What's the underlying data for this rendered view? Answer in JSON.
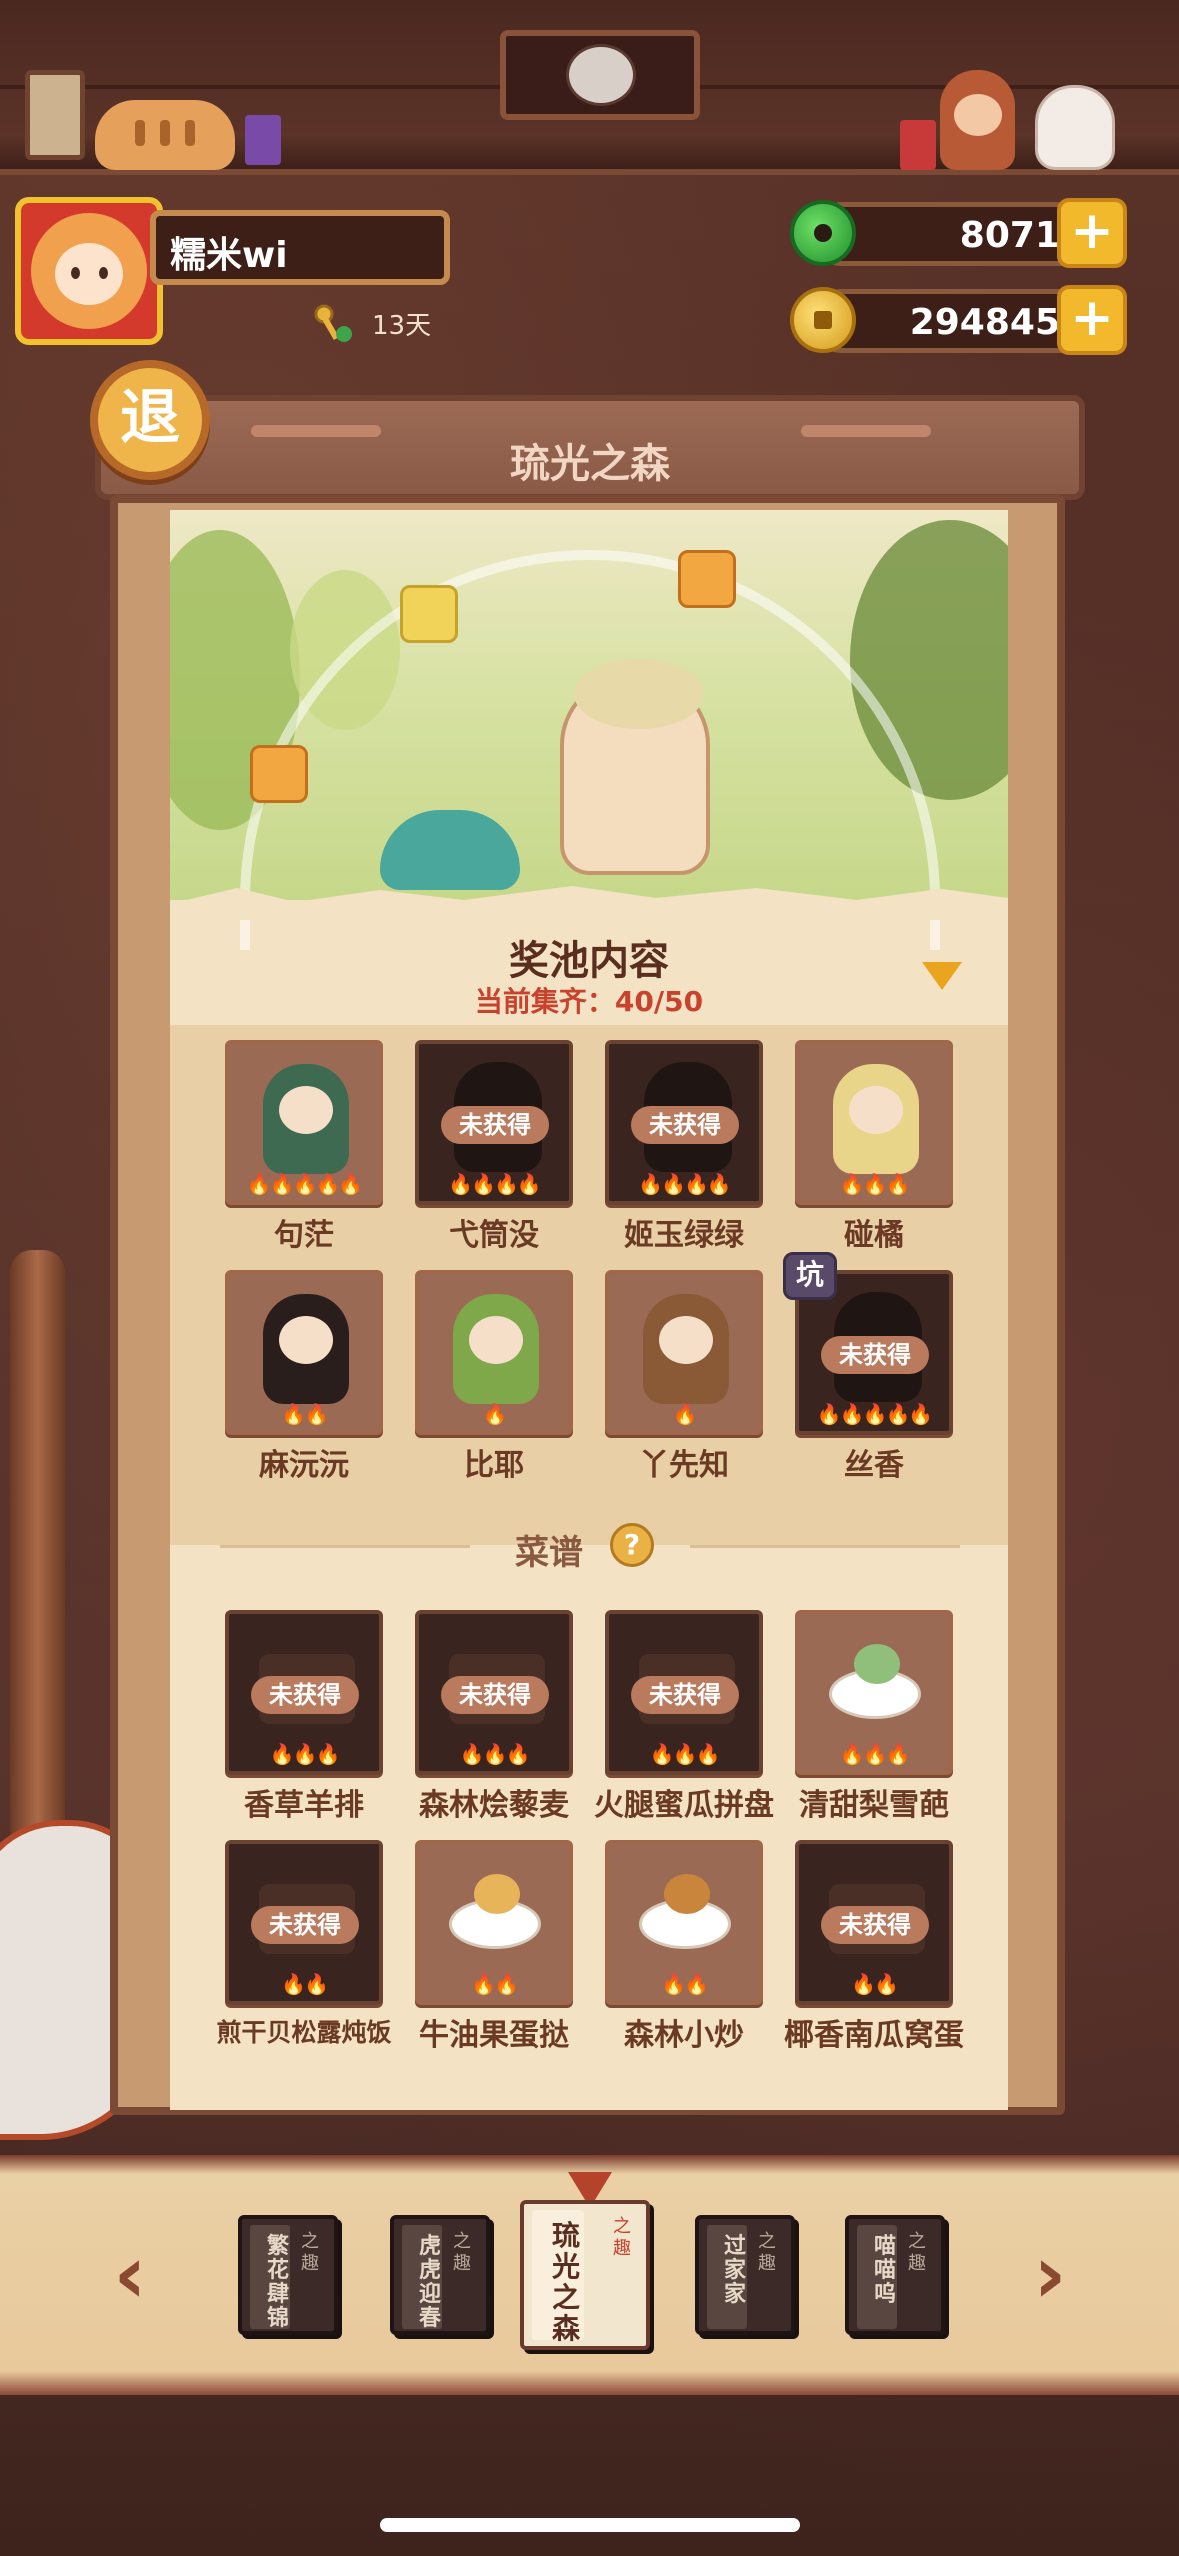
{
  "player": {
    "name": "糯米wi",
    "days": "13天"
  },
  "resources": {
    "jade": "8071",
    "coins": "294845",
    "plus": "+"
  },
  "exit_label": "退",
  "title": "琉光之森",
  "pool": {
    "title": "奖池内容",
    "progress": "当前集齐：40/50"
  },
  "locked_badge": "未获得",
  "pit_tag": "坑",
  "characters": [
    {
      "name": "句茫",
      "owned": true,
      "flames": "🔥🔥🔥🔥🔥",
      "color": "#3e6a52"
    },
    {
      "name": "弋筒没",
      "owned": false,
      "flames": "🔥🔥🔥🔥"
    },
    {
      "name": "姬玉绿绿",
      "owned": false,
      "flames": "🔥🔥🔥🔥"
    },
    {
      "name": "碰橘",
      "owned": true,
      "flames": "🔥🔥🔥",
      "color": "#e9d58a"
    },
    {
      "name": "麻沅沅",
      "owned": true,
      "flames": "🔥🔥",
      "color": "#2a1e1c"
    },
    {
      "name": "比耶",
      "owned": true,
      "flames": "🔥",
      "color": "#7ea84a"
    },
    {
      "name": "丫先知",
      "owned": true,
      "flames": "🔥",
      "color": "#8a5a36"
    },
    {
      "name": "丝香",
      "owned": false,
      "flames": "🔥🔥🔥🔥🔥"
    }
  ],
  "recipes_title": "菜谱",
  "help_icon": "?",
  "recipes": [
    {
      "name": "香草羊排",
      "owned": false,
      "flames": "🔥🔥🔥"
    },
    {
      "name": "森林烩藜麦",
      "owned": false,
      "flames": "🔥🔥🔥"
    },
    {
      "name": "火腿蜜瓜拼盘",
      "owned": false,
      "flames": "🔥🔥🔥"
    },
    {
      "name": "清甜梨雪葩",
      "owned": true,
      "flames": "🔥🔥🔥"
    },
    {
      "name": "煎干贝松露炖饭",
      "owned": false,
      "flames": "🔥🔥"
    },
    {
      "name": "牛油果蛋挞",
      "owned": true,
      "flames": "🔥🔥"
    },
    {
      "name": "森林小炒",
      "owned": true,
      "flames": "🔥🔥"
    },
    {
      "name": "椰香南瓜窝蛋",
      "owned": false,
      "flames": "🔥🔥"
    }
  ],
  "nav": {
    "prev": "‹",
    "next": "›",
    "books": [
      {
        "title": "繁花肆锦",
        "seal": "之趣",
        "active": false
      },
      {
        "title": "虎虎迎春",
        "seal": "之趣",
        "active": false
      },
      {
        "title": "琉光之森",
        "seal": "之趣",
        "active": true
      },
      {
        "title": "过家家",
        "seal": "之趣",
        "active": false
      },
      {
        "title": "喵喵呜",
        "seal": "之趣",
        "active": false
      }
    ]
  }
}
